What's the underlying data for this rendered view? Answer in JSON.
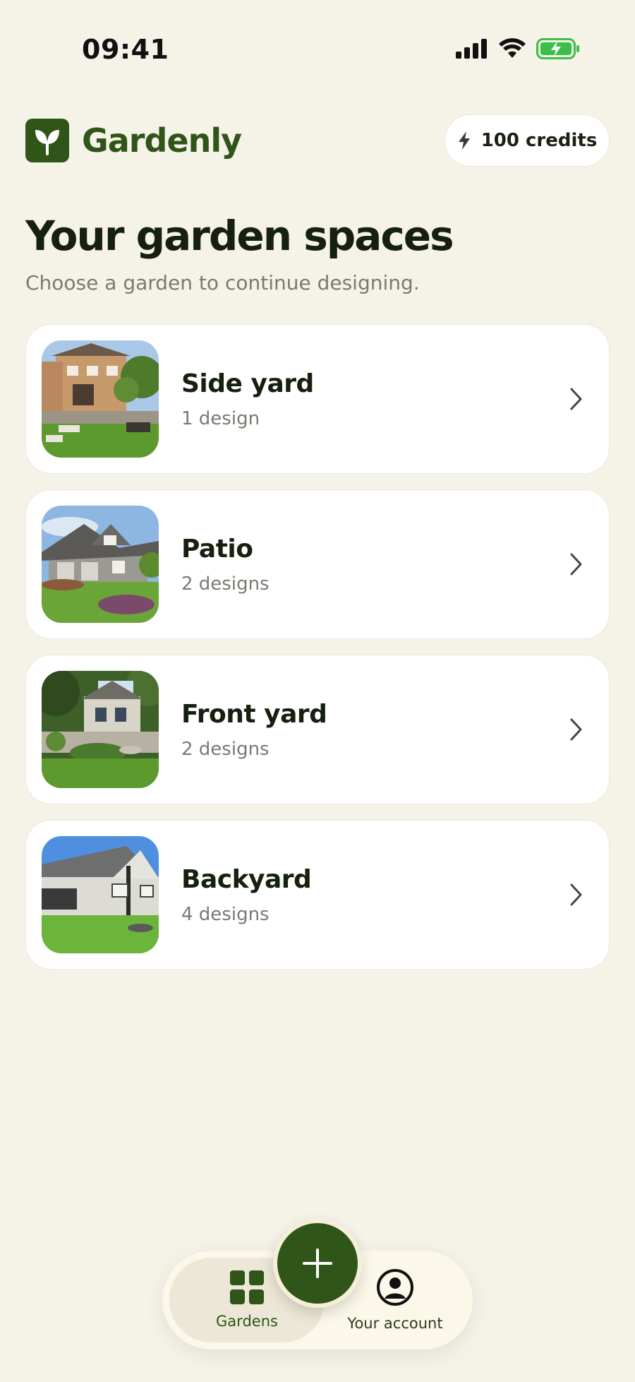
{
  "status_bar": {
    "time": "09:41"
  },
  "header": {
    "brand": "Gardenly",
    "credits_label": "100 credits"
  },
  "main": {
    "title": "Your garden spaces",
    "subtitle": "Choose a garden to continue designing.",
    "gardens": [
      {
        "name": "Side yard",
        "designs": "1 design"
      },
      {
        "name": "Patio",
        "designs": "2 designs"
      },
      {
        "name": "Front yard",
        "designs": "2 designs"
      },
      {
        "name": "Backyard",
        "designs": "4 designs"
      }
    ]
  },
  "bottom_nav": {
    "gardens_label": "Gardens",
    "account_label": "Your account"
  },
  "colors": {
    "brand": "#2f5518",
    "background": "#f5f2e8",
    "card": "#ffffff",
    "battery": "#3bbf4a"
  },
  "icons": [
    "signal-icon",
    "wifi-icon",
    "battery-charging-icon",
    "leaf-logo-icon",
    "lightning-icon",
    "chevron-right-icon",
    "grid-icon",
    "user-circle-icon",
    "plus-icon"
  ]
}
